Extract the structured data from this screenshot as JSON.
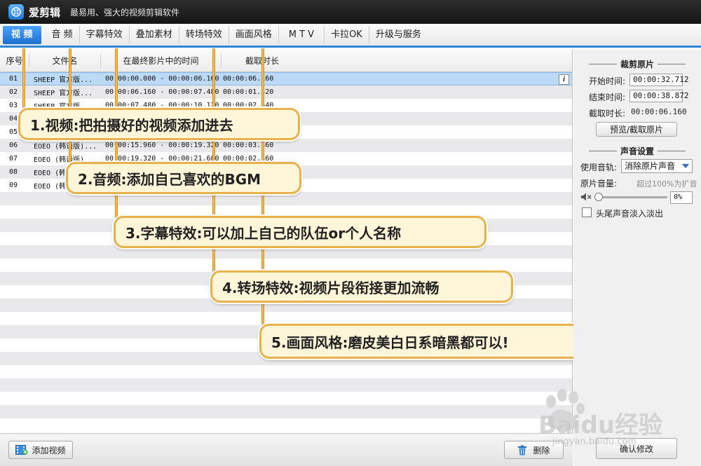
{
  "app": {
    "title": "爱剪辑",
    "slogan": "最易用、强大的视频剪辑软件"
  },
  "tabs": [
    {
      "label": "视 频",
      "active": true
    },
    {
      "label": "音 频",
      "active": false
    },
    {
      "label": "字幕特效",
      "active": false
    },
    {
      "label": "叠加素材",
      "active": false
    },
    {
      "label": "转场特效",
      "active": false
    },
    {
      "label": "画面风格",
      "active": false
    },
    {
      "label": "M T V",
      "active": false
    },
    {
      "label": "卡拉OK",
      "active": false
    },
    {
      "label": "升级与服务",
      "active": false
    }
  ],
  "table": {
    "headers": [
      "序号",
      "文件名",
      "在最终影片中的时间",
      "截取时长"
    ],
    "rows": [
      {
        "idx": "01",
        "name": "SHEEP 官方版...",
        "time": "00:00:00.000 - 00:00:06.160",
        "dur": "00:00:06.160",
        "selected": true
      },
      {
        "idx": "02",
        "name": "SHEEP 官方版...",
        "time": "00:00:06.160 - 00:00:07.480",
        "dur": "00:00:01.320",
        "selected": false
      },
      {
        "idx": "03",
        "name": "SHEEP 官方版...",
        "time": "00:00:07.480 - 00:00:10.120",
        "dur": "00:00:02.640",
        "selected": false
      },
      {
        "idx": "04",
        "name": "",
        "time": "",
        "dur": "",
        "selected": false
      },
      {
        "idx": "05",
        "name": "",
        "time": "",
        "dur": "",
        "selected": false
      },
      {
        "idx": "06",
        "name": "EOEO (韩语版)...",
        "time": "00:00:15.960 - 00:00:19.320",
        "dur": "00:00:03.360",
        "selected": false
      },
      {
        "idx": "07",
        "name": "EOEO (韩语版)...",
        "time": "00:00:19.320 - 00:00:21.680",
        "dur": "00:00:02.360",
        "selected": false
      },
      {
        "idx": "08",
        "name": "EOEO (韩语版)...",
        "time": "",
        "dur": "",
        "selected": false
      },
      {
        "idx": "09",
        "name": "EOEO (韩语版)...",
        "time": "",
        "dur": "",
        "selected": false
      }
    ]
  },
  "callouts": [
    "1.视频:把拍摄好的视频添加进去",
    "2.音频:添加自己喜欢的BGM",
    "3.字幕特效:可以加上自己的队伍or个人名称",
    "4.转场特效:视频片段衔接更加流畅",
    "5.画面风格:磨皮美白日系暗黑都可以!"
  ],
  "bottom": {
    "add_video": "添加视频",
    "delete": "删除",
    "confirm": "确认修改"
  },
  "crop": {
    "title": "裁剪原片",
    "start_label": "开始时间:",
    "start_value": "00:00:32.712",
    "end_label": "结束时间:",
    "end_value": "00:00:38.872",
    "dur_label": "截取时长:",
    "dur_value": "00:00:06.160",
    "preview_button": "预览/截取原片"
  },
  "audio": {
    "title": "声音设置",
    "track_label": "使用音轨:",
    "track_value": "消除原片声音",
    "volume_label": "原片音量:",
    "volume_hint": "超过100%为扩音",
    "volume_value": "0%",
    "volume_level": 0,
    "fade_label": "头尾声音淡入淡出",
    "fade_checked": false
  },
  "watermark": {
    "brand": "Baidu经验",
    "url": "jingyan.baidu.com"
  }
}
